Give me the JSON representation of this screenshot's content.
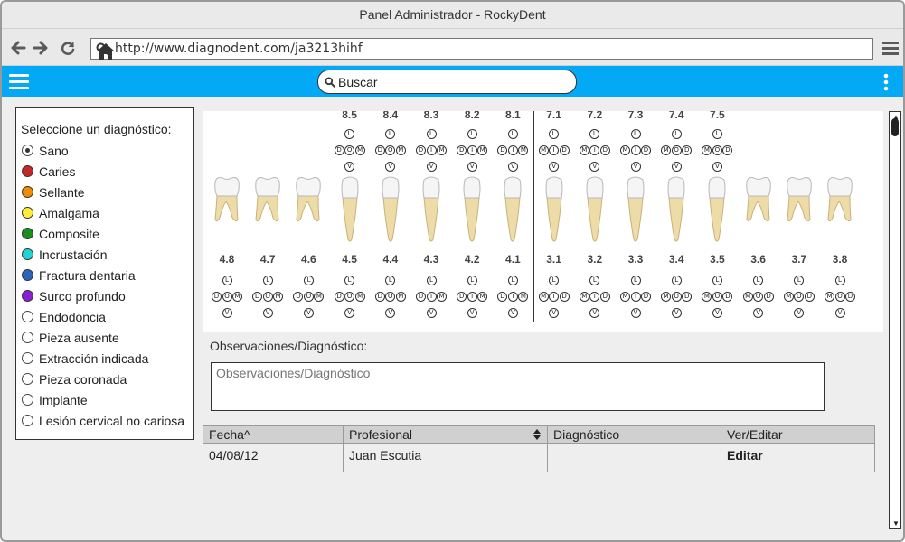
{
  "window": {
    "title": "Panel Administrador - RockyDent"
  },
  "browser": {
    "url": "http://www.diagnodent.com/ja3213hihf",
    "icons": [
      "back-arrow-icon",
      "forward-arrow-icon",
      "reload-icon",
      "search-icon",
      "home-icon",
      "menu-icon"
    ]
  },
  "appbar": {
    "search_placeholder": "Buscar",
    "icons": [
      "hamburger-icon",
      "search-icon",
      "kebab-menu-icon"
    ]
  },
  "diagnosis": {
    "title": "Seleccione un diagnóstico:",
    "selected": "Sano",
    "options": [
      {
        "label": "Sano",
        "color": ""
      },
      {
        "label": "Caries",
        "color": "#c62828"
      },
      {
        "label": "Sellante",
        "color": "#ef8c00"
      },
      {
        "label": "Amalgama",
        "color": "#ffeb3b"
      },
      {
        "label": "Composite",
        "color": "#1b8e1b"
      },
      {
        "label": "Incrustación",
        "color": "#22d3d3"
      },
      {
        "label": "Fractura dentaria",
        "color": "#2c63b8"
      },
      {
        "label": "Surco profundo",
        "color": "#8a1fd6"
      },
      {
        "label": "Endodoncia",
        "color": ""
      },
      {
        "label": "Pieza ausente",
        "color": ""
      },
      {
        "label": "Extracción indicada",
        "color": ""
      },
      {
        "label": "Pieza coronada",
        "color": ""
      },
      {
        "label": "Implante",
        "color": ""
      },
      {
        "label": "Lesión cervical no cariosa",
        "color": ""
      }
    ]
  },
  "odontogram": {
    "upper": [
      {
        "num": "8.5",
        "faces": [
          "D",
          "O",
          "M"
        ]
      },
      {
        "num": "8.4",
        "faces": [
          "D",
          "O",
          "M"
        ]
      },
      {
        "num": "8.3",
        "faces": [
          "D",
          "I",
          "M"
        ]
      },
      {
        "num": "8.2",
        "faces": [
          "D",
          "I",
          "M"
        ]
      },
      {
        "num": "8.1",
        "faces": [
          "D",
          "I",
          "M"
        ]
      },
      {
        "num": "7.1",
        "faces": [
          "M",
          "I",
          "D"
        ]
      },
      {
        "num": "7.2",
        "faces": [
          "M",
          "I",
          "D"
        ]
      },
      {
        "num": "7.3",
        "faces": [
          "M",
          "I",
          "D"
        ]
      },
      {
        "num": "7.4",
        "faces": [
          "M",
          "O",
          "D"
        ]
      },
      {
        "num": "7.5",
        "faces": [
          "M",
          "O",
          "D"
        ]
      }
    ],
    "lower": [
      {
        "num": "4.8",
        "faces": [
          "D",
          "O",
          "M"
        ]
      },
      {
        "num": "4.7",
        "faces": [
          "D",
          "O",
          "M"
        ]
      },
      {
        "num": "4.6",
        "faces": [
          "D",
          "O",
          "M"
        ]
      },
      {
        "num": "4.5",
        "faces": [
          "D",
          "O",
          "M"
        ]
      },
      {
        "num": "4.4",
        "faces": [
          "D",
          "O",
          "M"
        ]
      },
      {
        "num": "4.3",
        "faces": [
          "D",
          "I",
          "M"
        ]
      },
      {
        "num": "4.2",
        "faces": [
          "D",
          "I",
          "M"
        ]
      },
      {
        "num": "4.1",
        "faces": [
          "D",
          "I",
          "M"
        ]
      },
      {
        "num": "3.1",
        "faces": [
          "M",
          "I",
          "D"
        ]
      },
      {
        "num": "3.2",
        "faces": [
          "M",
          "I",
          "D"
        ]
      },
      {
        "num": "3.3",
        "faces": [
          "M",
          "I",
          "D"
        ]
      },
      {
        "num": "3.4",
        "faces": [
          "M",
          "O",
          "D"
        ]
      },
      {
        "num": "3.5",
        "faces": [
          "M",
          "O",
          "D"
        ]
      },
      {
        "num": "3.6",
        "faces": [
          "M",
          "O",
          "D"
        ]
      },
      {
        "num": "3.7",
        "faces": [
          "M",
          "O",
          "D"
        ]
      },
      {
        "num": "3.8",
        "faces": [
          "M",
          "O",
          "D"
        ]
      }
    ],
    "face_top": "L",
    "face_bottom": "V"
  },
  "observations": {
    "label": "Observaciones/Diagnóstico:",
    "placeholder": "Observaciones/Diagnóstico"
  },
  "history": {
    "headers": [
      "Fecha^",
      "Profesional",
      "Diagnóstico",
      "Ver/Editar"
    ],
    "rows": [
      {
        "fecha": "04/08/12",
        "profesional": "Juan Escutia",
        "diagnostico": "",
        "action": "Editar"
      }
    ]
  }
}
